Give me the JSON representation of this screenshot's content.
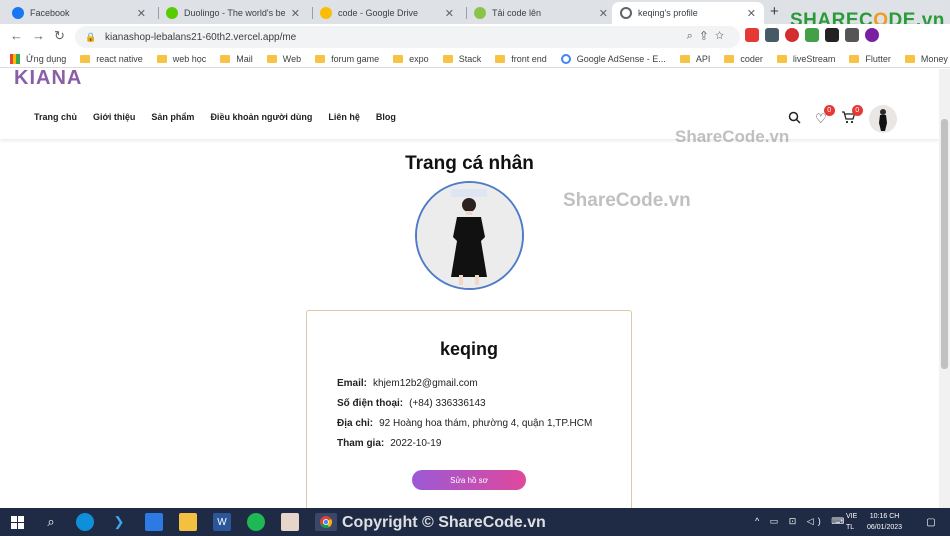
{
  "browser": {
    "tabs": [
      {
        "title": "Facebook",
        "favicon_color": "#1877f2"
      },
      {
        "title": "Duolingo - The world's best",
        "favicon_color": "#58cc02"
      },
      {
        "title": "code - Google Drive",
        "favicon_color": "#fbbc05"
      },
      {
        "title": "Tải code lên",
        "favicon_color": "#8bc34a"
      },
      {
        "title": "keqing's profile",
        "favicon_color": "#5f6368",
        "active": true
      }
    ],
    "url": "kianashop-lebalans21-60th2.vercel.app/me",
    "bookmarks": [
      {
        "label": "Ứng dụng",
        "icon": "apps-grid-icon"
      },
      {
        "label": "react native",
        "icon": "folder-icon"
      },
      {
        "label": "web học",
        "icon": "folder-icon"
      },
      {
        "label": "Mail",
        "icon": "folder-icon"
      },
      {
        "label": "Web",
        "icon": "folder-icon"
      },
      {
        "label": "forum game",
        "icon": "folder-icon"
      },
      {
        "label": "expo",
        "icon": "folder-icon"
      },
      {
        "label": "Stack",
        "icon": "folder-icon"
      },
      {
        "label": "front end",
        "icon": "folder-icon"
      },
      {
        "label": "Google AdSense - E...",
        "icon": "google-icon"
      },
      {
        "label": "API",
        "icon": "folder-icon"
      },
      {
        "label": "coder",
        "icon": "folder-icon"
      },
      {
        "label": "liveStream",
        "icon": "folder-icon"
      },
      {
        "label": "Flutter",
        "icon": "folder-icon"
      },
      {
        "label": "Money",
        "icon": "folder-icon"
      }
    ]
  },
  "site": {
    "brand": "KIANA",
    "nav": [
      "Trang chủ",
      "Giới thiệu",
      "Sản phẩm",
      "Điều khoản người dùng",
      "Liên hệ",
      "Blog"
    ],
    "wishlist_count": "0",
    "cart_count": "0",
    "accent": "#8b5fa8"
  },
  "profile": {
    "page_title": "Trang cá nhân",
    "name": "keqing",
    "fields": [
      {
        "label": "Email:",
        "value": "khjem12b2@gmail.com"
      },
      {
        "label": "Số điện thoại:",
        "value": "(+84) 336336143"
      },
      {
        "label": "Địa chỉ:",
        "value": "92 Hoàng hoa thám, phường 4, quận 1,TP.HCM"
      },
      {
        "label": "Tham gia:",
        "value": "2022-10-19"
      }
    ],
    "edit_button": "Sửa hồ sơ"
  },
  "watermarks": {
    "a": "ShareCode.vn",
    "b": "ShareCode.vn",
    "copyright": "Copyright © ShareCode.vn",
    "logo_pre": "SHAREC",
    "logo_o": "O",
    "logo_post": "DE.vn"
  },
  "taskbar": {
    "lang_1": "VIE",
    "lang_2": "TL",
    "time": "10:16 CH",
    "date": "06/01/2023"
  }
}
